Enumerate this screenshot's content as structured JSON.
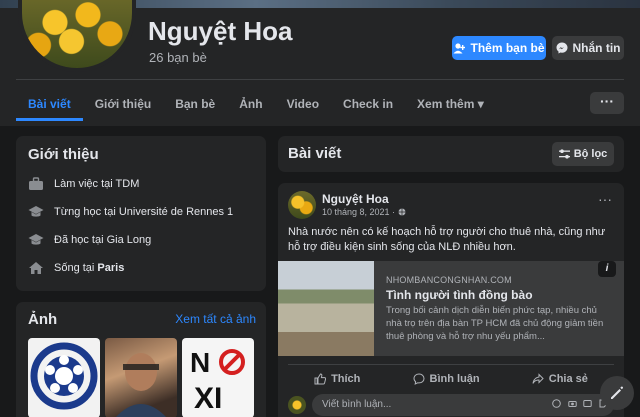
{
  "profile": {
    "name": "Nguyệt Hoa",
    "friends": "26 bạn bè"
  },
  "actions": {
    "add_friend": "Thêm bạn bè",
    "message": "Nhắn tin",
    "more": "···"
  },
  "tabs": [
    {
      "label": "Bài viết",
      "active": true
    },
    {
      "label": "Giới thiệu"
    },
    {
      "label": "Bạn bè"
    },
    {
      "label": "Ảnh"
    },
    {
      "label": "Video"
    },
    {
      "label": "Check in"
    },
    {
      "label": "Xem thêm ▾"
    }
  ],
  "intro": {
    "title": "Giới thiệu",
    "items": [
      {
        "text": "Làm việc tại TDM",
        "icon": "briefcase-icon"
      },
      {
        "text": "Từng học tại Université de Rennes 1",
        "icon": "graduation-cap-icon"
      },
      {
        "text": "Đã học tại Gia Long",
        "icon": "graduation-cap-icon"
      },
      {
        "prefix": "Sống tại ",
        "strong": "Paris",
        "icon": "home-icon"
      }
    ]
  },
  "photos": {
    "title": "Ảnh",
    "see_all": "Xem tất cả ảnh"
  },
  "posts": {
    "title": "Bài viết",
    "filter": "Bộ lọc"
  },
  "post": {
    "author": "Nguyệt Hoa",
    "time": "10 tháng 8, 2021 · ",
    "text": "Nhà nước nên có kế hoạch hỗ trợ người cho thuê nhà, cũng như hỗ trợ điều kiện sinh sống của NLĐ nhiều hơn.",
    "link": {
      "site": "NHOMBANCONGNHAN.COM",
      "title": "Tình người tình đồng bào",
      "description": "Trong bối cảnh dịch diễn biến phức tạp, nhiều chủ nhà trọ trên địa bàn TP HCM đã chủ động giảm tiền thuê phòng và hỗ trợ nhu yếu phẩm..."
    },
    "like": "Thích",
    "comment": "Bình luận",
    "share": "Chia sẻ",
    "comment_placeholder": "Viết bình luận..."
  }
}
